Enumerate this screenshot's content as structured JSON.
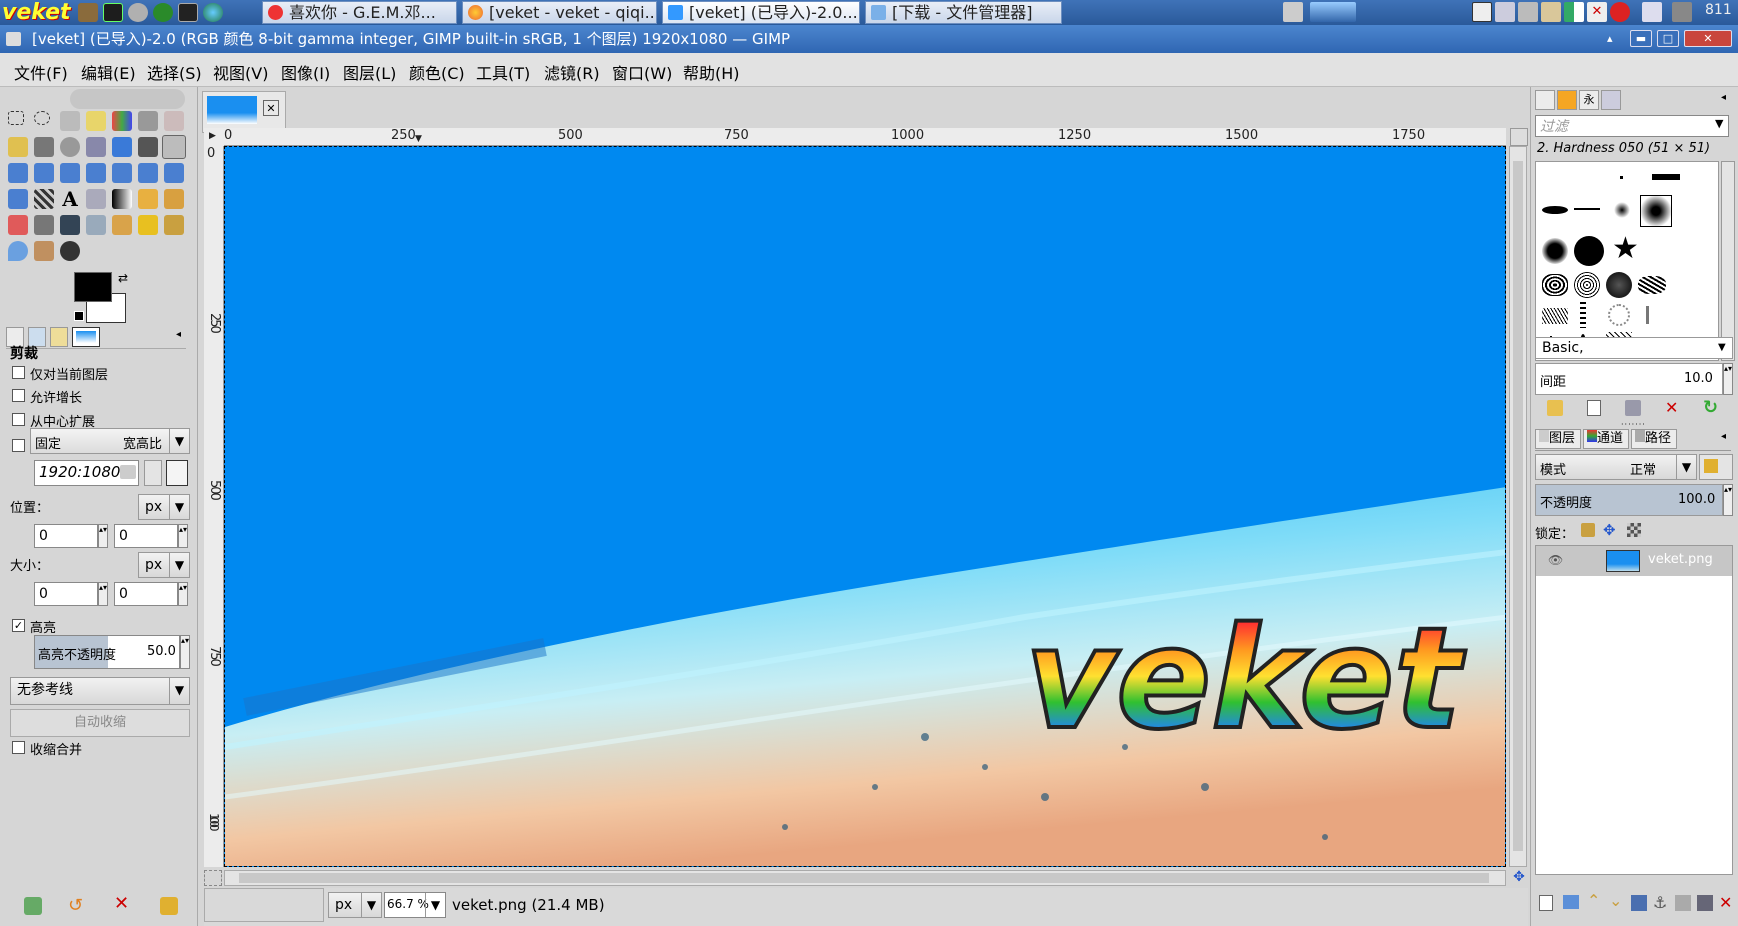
{
  "taskbar": {
    "logo": "veket",
    "tasks": [
      {
        "label": "喜欢你 - G.E.M.邓..."
      },
      {
        "label": "[veket - veket - qiqi..."
      },
      {
        "label": "[veket] (已导入)-2.0..."
      },
      {
        "label": "[下载 - 文件管理器]"
      }
    ],
    "clock": "811"
  },
  "window": {
    "title": "[veket] (已导入)-2.0 (RGB 颜色 8-bit gamma integer, GIMP built-in sRGB, 1 个图层) 1920x1080 — GIMP",
    "min": "▬",
    "max": "□",
    "close": "✕"
  },
  "menubar": {
    "items": [
      "文件(F)",
      "编辑(E)",
      "选择(S)",
      "视图(V)",
      "图像(I)",
      "图层(L)",
      "颜色(C)",
      "工具(T)",
      "滤镜(R)",
      "窗口(W)",
      "帮助(H)"
    ]
  },
  "tool_options": {
    "section_title": "剪裁",
    "current_layer_only": "仅对当前图层",
    "allow_growing": "允许增长",
    "expand_from_center": "从中心扩展",
    "fixed_label": "固定",
    "fixed_mode": "宽高比",
    "ratio_value": "1920:1080",
    "position_label": "位置：",
    "position_unit": "px",
    "position_x": "0",
    "position_y": "0",
    "size_label": "大小：",
    "size_unit": "px",
    "size_w": "0",
    "size_h": "0",
    "highlight_label": "高亮",
    "highlight_opacity_label": "高亮不透明度",
    "highlight_opacity_value": "50.0",
    "guides": "无参考线",
    "auto_shrink": "自动收缩",
    "shrink_merged": "收缩合并"
  },
  "rulers": {
    "h_ticks": [
      "0",
      "250",
      "500",
      "750",
      "1000",
      "1250",
      "1500",
      "1750"
    ],
    "v_ticks": [
      "0",
      "250",
      "500",
      "750",
      "1000"
    ]
  },
  "canvas": {
    "overlay_text": "veket"
  },
  "statusbar": {
    "unit": "px",
    "zoom": "66.7 %",
    "file_info": "veket.png (21.4 MB)"
  },
  "brushes": {
    "filter_placeholder": "过滤",
    "selected_brush": "2. Hardness 050 (51 × 51)",
    "tag_value": "Basic,",
    "spacing_label": "间距",
    "spacing_value": "10.0"
  },
  "layers": {
    "tabs": [
      "图层",
      "通道",
      "路径"
    ],
    "mode_label": "模式",
    "mode_value": "正常",
    "opacity_label": "不透明度",
    "opacity_value": "100.0",
    "lock_label": "锁定：",
    "layer_name": "veket.png"
  },
  "colors": {
    "canvas_blue": "#0089f0",
    "foreground": "#000000",
    "background": "#ffffff"
  }
}
